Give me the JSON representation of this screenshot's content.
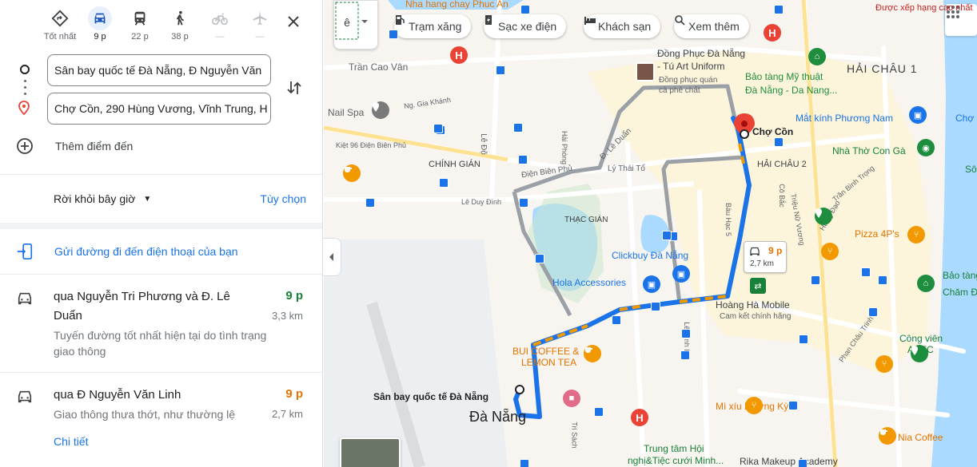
{
  "modes": [
    {
      "label": "Tốt nhất",
      "icon": "best-route-icon",
      "active": false
    },
    {
      "label": "9 p",
      "icon": "car-icon",
      "active": true
    },
    {
      "label": "22 p",
      "icon": "transit-icon",
      "active": false
    },
    {
      "label": "38 p",
      "icon": "walk-icon",
      "active": false
    },
    {
      "label": "—",
      "icon": "bicycle-icon",
      "active": false
    },
    {
      "label": "—",
      "icon": "flight-icon",
      "active": false
    }
  ],
  "inputs": {
    "origin": "Sân bay quốc tế Đà Nẵng, Đ Nguyễn Văn",
    "destination": "Chợ Cồn, 290 Hùng Vương, Vĩnh Trung, H",
    "add_destination": "Thêm điểm đến"
  },
  "depart": {
    "label": "Rời khỏi bây giờ",
    "options": "Tùy chọn"
  },
  "send_to_phone": "Gửi đường đi đến điện thoại của bạn",
  "routes": [
    {
      "title": "qua Nguyễn Tri Phương và Đ. Lê Duẩn",
      "time": "9 p",
      "distance": "3,3 km",
      "desc": "Tuyến đường tốt nhất hiện tại do tình trạng giao thông",
      "time_color": "#188038"
    },
    {
      "title": "qua Đ Nguyễn Văn Linh",
      "time": "9 p",
      "distance": "2,7 km",
      "desc": "Giao thông thưa thớt, như thường lệ",
      "detail": "Chi tiết",
      "time_color": "#e37400"
    }
  ],
  "map": {
    "chips": [
      "Trạm xăng",
      "Sạc xe điện",
      "Khách sạn",
      "Xem thêm"
    ],
    "callout": {
      "time": "9 p",
      "distance": "2,7 km"
    },
    "labels": {
      "top_ad": "Nha hang chay Phuc An",
      "report": "Được xếp hạng cao nhất",
      "hai_chau_1": "HẢI CHÂU 1",
      "hai_chau_2": "HẢI CHÂU 2",
      "chinh_gian": "CHÍNH GIÁN",
      "thac_gian": "THẠC GIÁN",
      "da_nang": "Đà Nẵng",
      "tran_cao_van": "Trần Cao Vân",
      "nail_spa": "Nail Spa",
      "dong_phuc_1": "Đồng Phục Đà Nẵng",
      "dong_phuc_2": "- Tú Art Uniform",
      "dong_phuc_3": "Đồng phục quán",
      "dong_phuc_4": "cà phê chất",
      "bao_tang_1": "Bảo tàng Mỹ thuật",
      "bao_tang_2": "Đà Nẵng - Da Nang...",
      "cho_con": "Chợ Cồn",
      "mat_kinh": "Mắt kính Phương Nam",
      "cho": "Chợ",
      "nha_tho": "Nhà Thờ Con Gà",
      "pizza": "Pizza 4P's",
      "clickbuy": "Clickbuy Đà Nẵng",
      "hola": "Hola Accessories",
      "hoang_ha_1": "Hoàng Hà Mobile",
      "hoang_ha_2": "Cam kết chính hãng",
      "bui_1": "BUI COFFEE &",
      "bui_2": "LEMON TEA",
      "san_bay": "Sân bay quốc tế Đà Nẵng",
      "mi_xiu": "Mì xíu Hương Kỳ",
      "trung_tam_1": "Trung tâm Hội",
      "trung_tam_2": "nghị&Tiệc cưới Minh...",
      "rika": "Rika Makeup Academy",
      "nia": "Nia Coffee",
      "cong_vien_1": "Công viên",
      "cong_vien_2": "APEC",
      "bao_tang_cham_1": "Bảo tàng",
      "bao_tang_cham_2": "Chăm Đà",
      "ng_gia_khanh": "Ng. Gia Khánh",
      "dien_bien_phu": "Điện Biên Phủ",
      "kiet_96": "Kiệt 96 Điện Biên Phủ",
      "le_do": "Lê Độ",
      "ly_thai_to": "Lý Thái Tổ",
      "le_duy_dinh": "Lê Duy Đình",
      "d_le_duan": "Đ. Lê Duẩn",
      "hai_phong": "Hải Phòng",
      "bau_hac_5": "Bàu Hạc 5",
      "trieu_nu_vuong": "Triệu Nữ Vương",
      "co_bac": "Cô Bắc",
      "hung_dao": "Hưng Đạo",
      "tran_binh_trong": "Trần Bình Trọng",
      "le_dinh_ly": "Lê Đình Lý",
      "phan_chau_trinh": "Phan Châu Trinh",
      "tri_sach": "Tri Sách",
      "so": "Sô"
    }
  }
}
